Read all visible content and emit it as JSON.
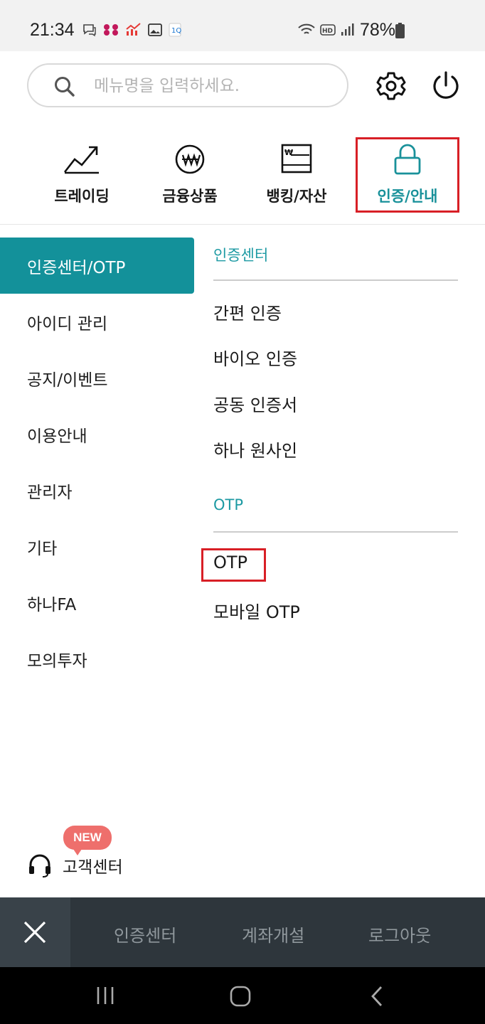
{
  "status_bar": {
    "time": "21:34",
    "battery": "78%"
  },
  "search": {
    "placeholder": "메뉴명을 입력하세요."
  },
  "top_icons": {
    "settings": "gear-icon",
    "power": "power-icon"
  },
  "categories": [
    {
      "label": "트레이딩",
      "icon": "trend-chart-icon"
    },
    {
      "label": "금융상품",
      "icon": "won-coin-icon"
    },
    {
      "label": "뱅킹/자산",
      "icon": "bank-statement-icon"
    },
    {
      "label": "인증/안내",
      "icon": "lock-icon",
      "active": true
    }
  ],
  "sidebar": {
    "items": [
      {
        "label": "인증센터/OTP",
        "active": true
      },
      {
        "label": "아이디 관리"
      },
      {
        "label": "공지/이벤트"
      },
      {
        "label": "이용안내"
      },
      {
        "label": "관리자"
      },
      {
        "label": "기타"
      },
      {
        "label": "하나FA"
      },
      {
        "label": "모의투자"
      }
    ]
  },
  "submenu": {
    "sections": [
      {
        "title": "인증센터",
        "items": [
          "간편 인증",
          "바이오 인증",
          "공동 인증서",
          "하나 원사인"
        ]
      },
      {
        "title": "OTP",
        "items": [
          "OTP",
          "모바일 OTP"
        ]
      }
    ]
  },
  "customer_center": {
    "badge": "NEW",
    "label": "고객센터"
  },
  "bottom_bar": {
    "links": [
      "인증센터",
      "계좌개설",
      "로그아웃"
    ]
  },
  "colors": {
    "accent": "#13919a",
    "highlight": "#d81f26",
    "bottom_bar": "#2e363c",
    "badge": "#ee6f6c"
  }
}
